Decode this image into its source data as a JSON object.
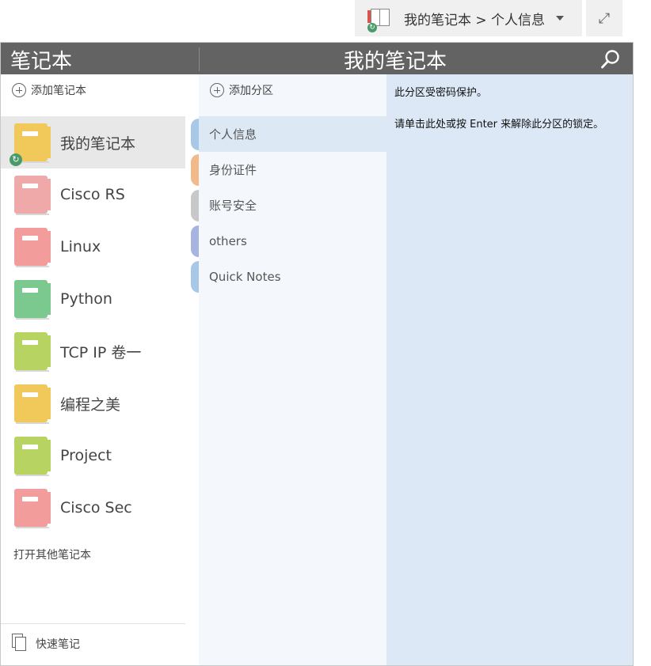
{
  "topbar": {
    "breadcrumb": "我的笔记本 > 个人信息",
    "expand_glyph": "⤢"
  },
  "header": {
    "left_title": "笔记本",
    "center_title": "我的笔记本"
  },
  "notebooks_pane": {
    "add_label": "添加笔记本",
    "items": [
      {
        "name": "我的笔记本",
        "color": "#f0c95a",
        "selected": true,
        "syncing": true
      },
      {
        "name": "Cisco RS",
        "color": "#f0a9a9"
      },
      {
        "name": "Linux",
        "color": "#f29c9c"
      },
      {
        "name": "Python",
        "color": "#7cc98f"
      },
      {
        "name": "TCP IP 卷一",
        "color": "#b7d462"
      },
      {
        "name": "编程之美",
        "color": "#f0c95a"
      },
      {
        "name": "Project",
        "color": "#b7d462"
      },
      {
        "name": "Cisco Sec",
        "color": "#f29c9c"
      }
    ],
    "open_other_label": "打开其他笔记本",
    "quick_notes_label": "快速笔记"
  },
  "sections_pane": {
    "add_label": "添加分区",
    "items": [
      {
        "name": "个人信息",
        "color": "#a8c8e8",
        "selected": true
      },
      {
        "name": "身份证件",
        "color": "#f2b98a"
      },
      {
        "name": "账号安全",
        "color": "#c8c8c8"
      },
      {
        "name": "others",
        "color": "#a8b4e0"
      },
      {
        "name": "Quick Notes",
        "color": "#a8c8e8"
      }
    ]
  },
  "content": {
    "line1": "此分区受密码保护。",
    "line2": "请单击此处或按 Enter 来解除此分区的锁定。"
  }
}
